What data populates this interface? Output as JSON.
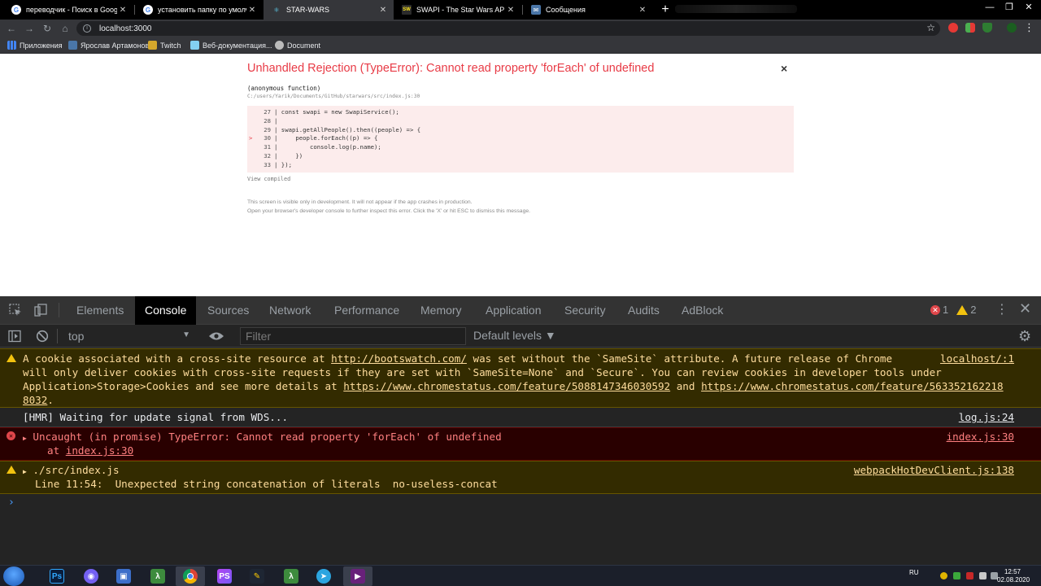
{
  "browser": {
    "tabs": [
      {
        "title": "переводчик - Поиск в Google",
        "favicon": "google-g-icon"
      },
      {
        "title": "установить папку по умолчани",
        "favicon": "google-g-icon"
      },
      {
        "title": "STAR-WARS",
        "favicon": "react-icon"
      },
      {
        "title": "SWAPI - The Star Wars API",
        "favicon": "swapi-icon"
      },
      {
        "title": "Сообщения",
        "favicon": "messages-icon"
      }
    ],
    "url": "localhost:3000",
    "bookmarks": [
      {
        "label": "Приложения",
        "icon": "apps-grid-icon"
      },
      {
        "label": "Ярослав Артамонов",
        "icon": "vk-icon"
      },
      {
        "label": "Twitch",
        "icon": "folder-icon"
      },
      {
        "label": "Веб-документация...",
        "icon": "mdn-icon"
      },
      {
        "label": "Document",
        "icon": "globe-icon"
      }
    ]
  },
  "overlay": {
    "title": "Unhandled Rejection (TypeError): Cannot read property 'forEach' of undefined",
    "close": "×",
    "frame_fn": "(anonymous function)",
    "frame_file": "C:/users/Yarik/Documents/GitHub/starwars/src/index.js:30",
    "code": [
      {
        "n": "27",
        "text": "const swapi = new SwapiService();",
        "marker": ""
      },
      {
        "n": "28",
        "text": "",
        "marker": ""
      },
      {
        "n": "29",
        "text": "swapi.getAllPeople().then((people) => {",
        "marker": ""
      },
      {
        "n": "30",
        "text": "    people.forEach((p) => {",
        "marker": ">"
      },
      {
        "n": "31",
        "text": "        console.log(p.name);",
        "marker": ""
      },
      {
        "n": "32",
        "text": "    })",
        "marker": ""
      },
      {
        "n": "33",
        "text": "});",
        "marker": ""
      }
    ],
    "view_compiled": "View compiled",
    "note_1": "This screen is visible only in development. It will not appear if the app crashes in production.",
    "note_2": "Open your browser's developer console to further inspect this error.  Click the 'X' or hit ESC to dismiss this message."
  },
  "devtools": {
    "tabs": [
      "Elements",
      "Console",
      "Sources",
      "Network",
      "Performance",
      "Memory",
      "Application",
      "Security",
      "Audits",
      "AdBlock"
    ],
    "active_tab": "Console",
    "error_count": "1",
    "warning_count": "2",
    "context": "top",
    "filter_placeholder": "Filter",
    "levels": "Default levels ▼",
    "messages": {
      "cookie": {
        "line1a": "A cookie associated with a cross-site resource at ",
        "link1": "http://bootswatch.com/",
        "line1b": " was set without the `SameSite` attribute. A future release of Chrome",
        "line2": "will only deliver cookies with cross-site requests if they are set with `SameSite=None` and `Secure`. You can review cookies in developer tools under",
        "line3a": "Application>Storage>Cookies and see more details at ",
        "link2": "https://www.chromestatus.com/feature/5088147346030592",
        "line3b": " and ",
        "link3a": "https://www.chromestatus.com/feature/563352162218",
        "link3b": "8032",
        "line4b": ".",
        "source": "localhost/:1"
      },
      "hmr": {
        "text": "[HMR] Waiting for update signal from WDS...",
        "source": "log.js:24"
      },
      "error": {
        "line1": "Uncaught (in promise) TypeError: Cannot read property 'forEach' of undefined",
        "line2_prefix": "at ",
        "line2_link": "index.js:30",
        "source": "index.js:30"
      },
      "lint": {
        "line1": "./src/index.js",
        "line2": "Line 11:54:  Unexpected string concatenation of literals  no-useless-concat",
        "source": "webpackHotDevClient.js:138"
      }
    },
    "prompt": "›"
  },
  "taskbar": {
    "apps": [
      "photoshop-icon",
      "viber-icon",
      "floppy-icon",
      "lambda-icon",
      "chrome-icon",
      "phpstorm-icon",
      "cyberduck-icon",
      "monster-icon",
      "telegram-icon",
      "visual-studio-icon"
    ],
    "language": "RU",
    "time": "12:57",
    "date": "02.08.2020"
  },
  "colors": {
    "error_red": "#e83b46",
    "warn_yellow": "#f2c20f",
    "devtools_bg": "#242424",
    "tab_active": "#35363a"
  }
}
